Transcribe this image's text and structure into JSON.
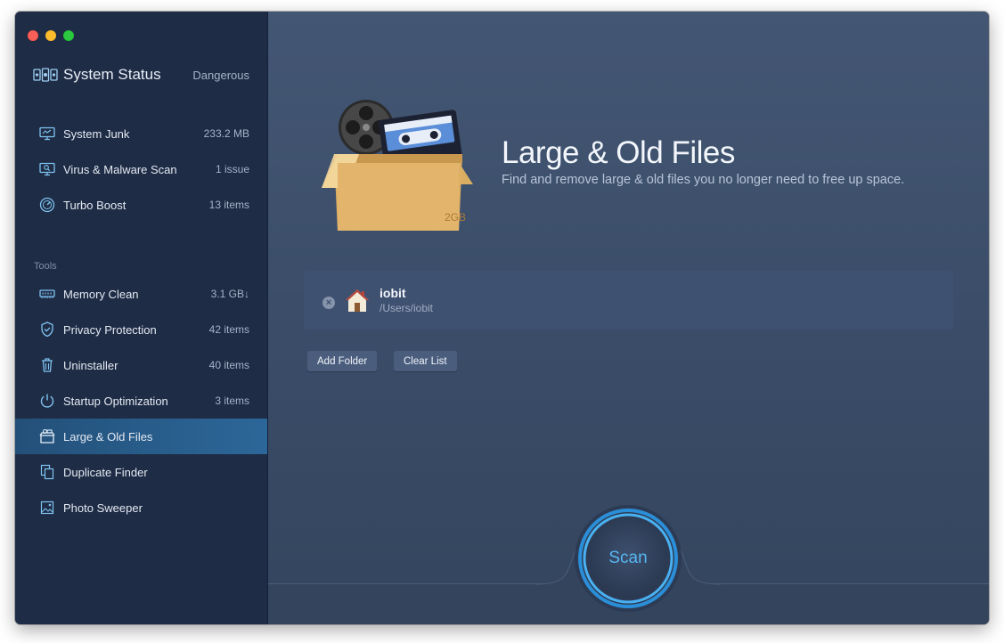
{
  "sidebar": {
    "status": {
      "title": "System Status",
      "value": "Dangerous"
    },
    "items": [
      {
        "label": "System Junk",
        "count": "233.2 MB",
        "icon": "monitor-icon"
      },
      {
        "label": "Virus & Malware Scan",
        "count": "1 issue",
        "icon": "virus-scan-icon"
      },
      {
        "label": "Turbo Boost",
        "count": "13 items",
        "icon": "speedometer-icon"
      }
    ],
    "tools_label": "Tools",
    "tools": [
      {
        "label": "Memory Clean",
        "count": "3.1 GB↓",
        "icon": "memory-chip-icon"
      },
      {
        "label": "Privacy Protection",
        "count": "42 items",
        "icon": "shield-icon"
      },
      {
        "label": "Uninstaller",
        "count": "40 items",
        "icon": "trash-icon"
      },
      {
        "label": "Startup Optimization",
        "count": "3 items",
        "icon": "power-icon"
      },
      {
        "label": "Large & Old Files",
        "count": "",
        "icon": "box-icon",
        "active": true
      },
      {
        "label": "Duplicate Finder",
        "count": "",
        "icon": "duplicate-icon"
      },
      {
        "label": "Photo Sweeper",
        "count": "",
        "icon": "photo-icon"
      }
    ]
  },
  "main": {
    "title": "Large & Old Files",
    "subtitle": "Find and remove large & old files you no longer need to free up space.",
    "box_label": "2GB",
    "folders": [
      {
        "name": "iobit",
        "path": "/Users/iobit"
      }
    ],
    "add_folder_label": "Add Folder",
    "clear_list_label": "Clear List",
    "scan_label": "Scan"
  },
  "colors": {
    "sidebar_bg": "#1f2c45",
    "main_bg": "#3c4d68",
    "accent": "#3ea3e8",
    "active_item": "#2c6799"
  }
}
